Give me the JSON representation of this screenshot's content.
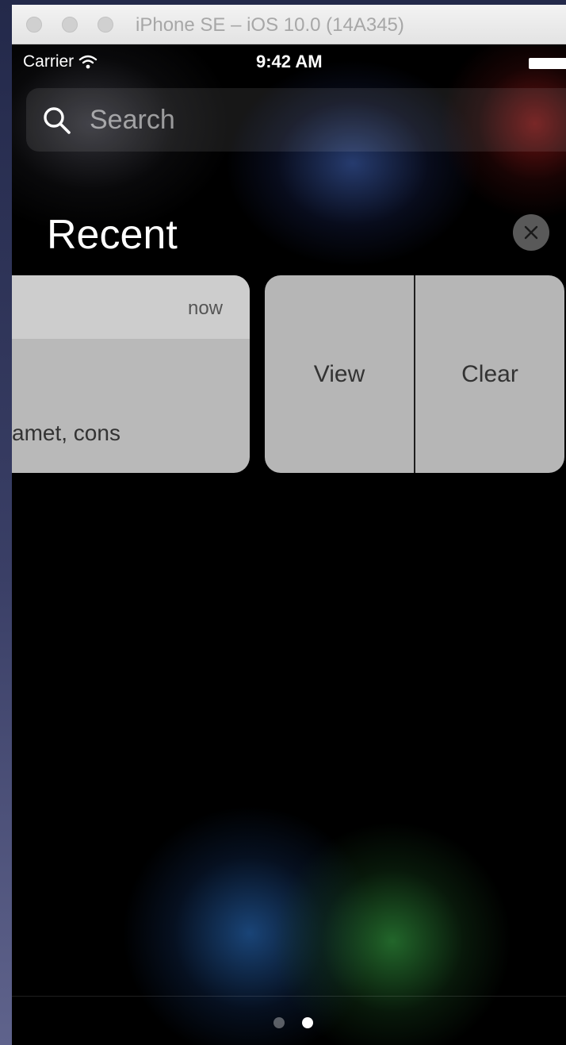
{
  "window": {
    "title": "iPhone SE – iOS 10.0 (14A345)"
  },
  "status_bar": {
    "carrier": "Carrier",
    "time": "9:42 AM",
    "wifi_icon": "wifi-icon",
    "battery_icon": "battery-icon"
  },
  "search": {
    "placeholder": "Search",
    "icon": "search-icon"
  },
  "recent": {
    "title": "Recent",
    "clear_icon": "close-icon"
  },
  "notification": {
    "time": "now",
    "body": "amet, cons"
  },
  "actions": {
    "view_label": "View",
    "clear_label": "Clear"
  },
  "page_indicator": {
    "count": 2,
    "active_index": 1
  },
  "colors": {
    "card_background": "#b9b9b9",
    "card_header": "#cdcdcd",
    "screen_background": "#000000"
  }
}
